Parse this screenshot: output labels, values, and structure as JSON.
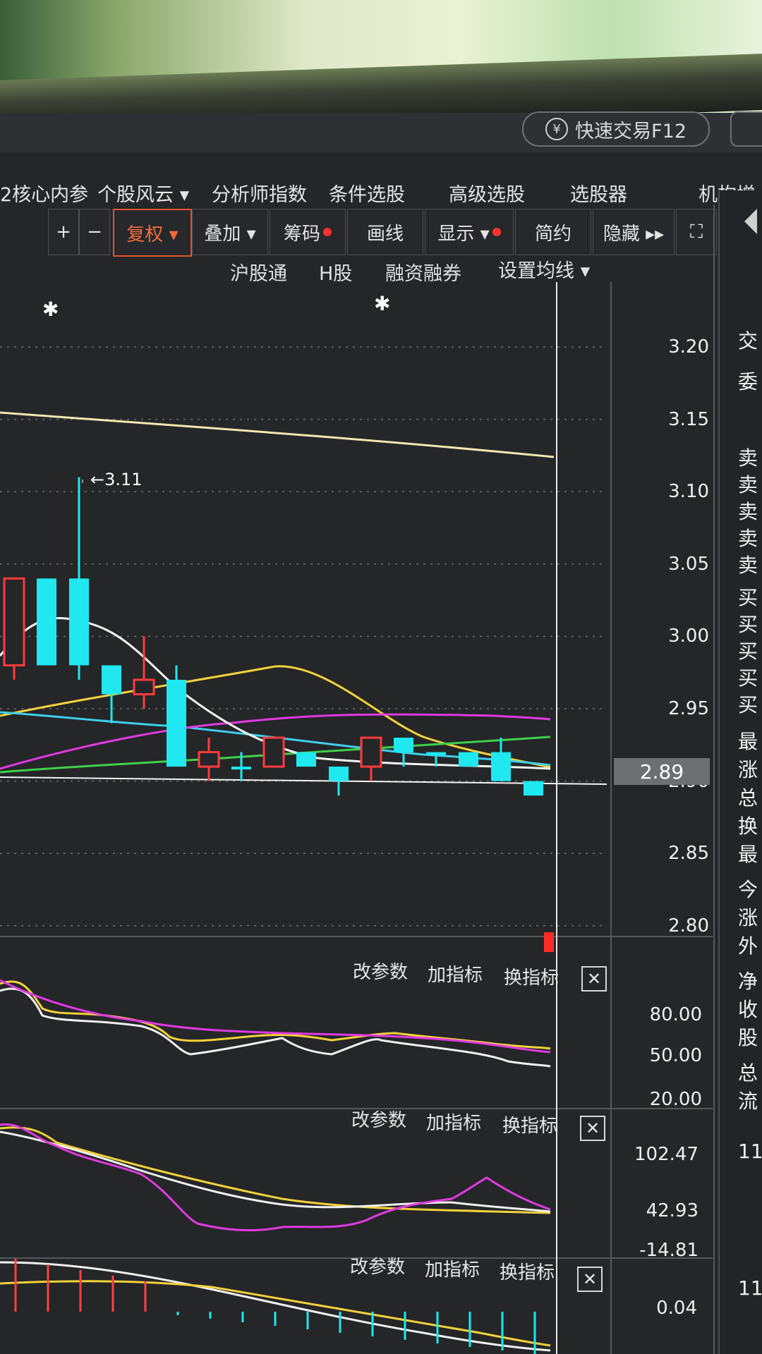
{
  "header": {
    "quick_trade": "快速交易F12",
    "quick_trade_icon": "yen-coin-icon"
  },
  "menu": [
    "2核心内参",
    "个股风云 ▾",
    "分析师指数",
    "条件选股",
    "高级选股",
    "选股器",
    "机构增"
  ],
  "toolbar": {
    "plus": "+",
    "minus": "−",
    "fuquan": "复权 ▾",
    "diejia": "叠加 ▾",
    "chouma": "筹码",
    "huaxian": "画线",
    "xianshi": "显示 ▾",
    "jianyue": "简约",
    "yincang": "隐藏 ▸▸",
    "fullscreen_icon": "fullscreen-icon"
  },
  "subbar": [
    "沪股通",
    "H股",
    "融资融券",
    "设置均线 ▾"
  ],
  "main_chart": {
    "peak_label": "←3.11",
    "price_axis": [
      "3.20",
      "3.15",
      "3.10",
      "3.05",
      "3.00",
      "2.95",
      "2.90",
      "2.85",
      "2.80"
    ],
    "current_price": "2.89"
  },
  "indicator_panels": [
    {
      "buttons": [
        "改参数",
        "加指标",
        "换指标"
      ],
      "axis": [
        "80.00",
        "50.00",
        "20.00"
      ]
    },
    {
      "buttons": [
        "改参数",
        "加指标",
        "换指标"
      ],
      "axis": [
        "102.47",
        "42.93",
        "-14.81"
      ]
    },
    {
      "buttons": [
        "改参数",
        "加指标",
        "换指标"
      ],
      "axis": [
        "0.04"
      ]
    }
  ],
  "right_panel": [
    "交",
    "委",
    "卖",
    "卖",
    "卖",
    "卖",
    "卖",
    "买",
    "买",
    "买",
    "买",
    "买",
    "最",
    "涨",
    "总",
    "换",
    "最",
    "今",
    "涨",
    "外",
    "净",
    "收",
    "股",
    "总",
    "流",
    "11",
    "11"
  ],
  "chart_data": {
    "type": "candlestick",
    "y_range": [
      2.78,
      3.22
    ],
    "peak_high": 3.11,
    "candles": [
      {
        "o": 2.98,
        "h": 3.04,
        "l": 2.97,
        "c": 3.04,
        "up": true
      },
      {
        "o": 3.04,
        "h": 3.04,
        "l": 2.98,
        "c": 2.98,
        "up": false
      },
      {
        "o": 3.04,
        "h": 3.11,
        "l": 2.97,
        "c": 2.98,
        "up": false
      },
      {
        "o": 2.98,
        "h": 2.98,
        "l": 2.94,
        "c": 2.96,
        "up": false
      },
      {
        "o": 2.96,
        "h": 3.0,
        "l": 2.95,
        "c": 2.97,
        "up": true
      },
      {
        "o": 2.97,
        "h": 2.98,
        "l": 2.91,
        "c": 2.91,
        "up": false
      },
      {
        "o": 2.91,
        "h": 2.93,
        "l": 2.9,
        "c": 2.92,
        "up": true
      },
      {
        "o": 2.91,
        "h": 2.92,
        "l": 2.9,
        "c": 2.91,
        "up": false
      },
      {
        "o": 2.91,
        "h": 2.93,
        "l": 2.91,
        "c": 2.93,
        "up": true
      },
      {
        "o": 2.92,
        "h": 2.92,
        "l": 2.91,
        "c": 2.91,
        "up": false
      },
      {
        "o": 2.91,
        "h": 2.91,
        "l": 2.89,
        "c": 2.9,
        "up": false
      },
      {
        "o": 2.91,
        "h": 2.93,
        "l": 2.9,
        "c": 2.93,
        "up": true
      },
      {
        "o": 2.93,
        "h": 2.93,
        "l": 2.91,
        "c": 2.92,
        "up": false
      },
      {
        "o": 2.92,
        "h": 2.92,
        "l": 2.91,
        "c": 2.92,
        "up": false
      },
      {
        "o": 2.91,
        "h": 2.92,
        "l": 2.91,
        "c": 2.92,
        "up": false
      },
      {
        "o": 2.92,
        "h": 2.93,
        "l": 2.9,
        "c": 2.9,
        "up": false
      },
      {
        "o": 2.9,
        "h": 2.9,
        "l": 2.89,
        "c": 2.89,
        "up": false
      }
    ]
  }
}
